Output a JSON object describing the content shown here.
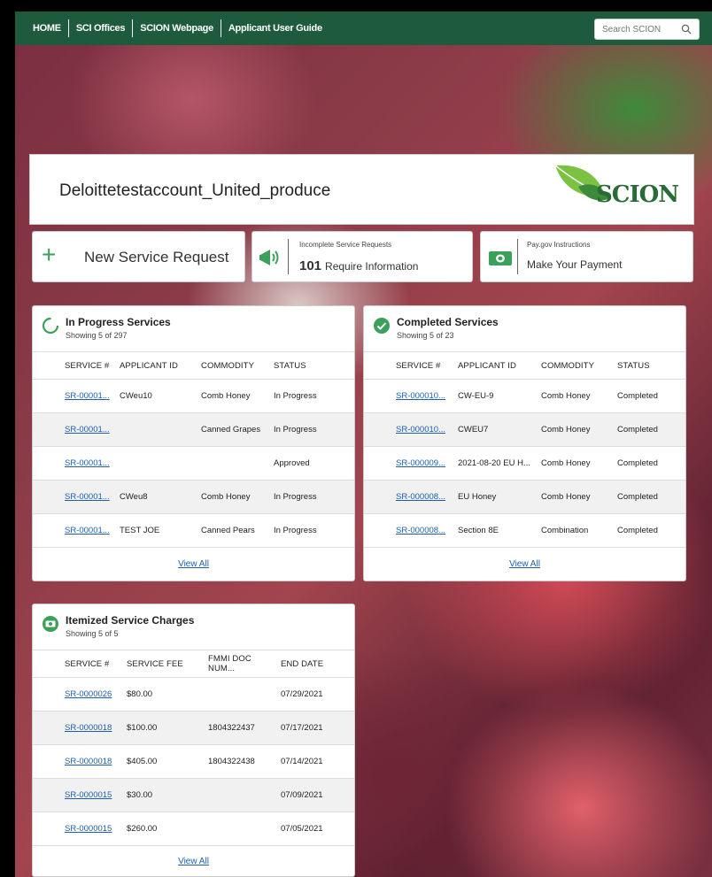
{
  "nav": {
    "items": [
      "HOME",
      "SCI Offices",
      "SCION Webpage",
      "Applicant User Guide"
    ],
    "search_placeholder": "Search SCION"
  },
  "account": {
    "name": "Deloittetestaccount_United_produce",
    "logo_text": "SCION"
  },
  "tiles": {
    "new_request": "New Service Request",
    "incomplete_small": "Incomplete Service Requests",
    "incomplete_count": "101",
    "incomplete_label": "Require Information",
    "paygov_small": "Pay.gov Instructions",
    "paygov_label": "Make Your Payment"
  },
  "in_progress": {
    "title": "In Progress Services",
    "showing": "Showing 5 of 297",
    "columns": [
      "SERVICE #",
      "APPLICANT ID",
      "COMMODITY",
      "STATUS"
    ],
    "rows": [
      [
        "SR-00001...",
        "CWeu10",
        "Comb Honey",
        "In Progress"
      ],
      [
        "SR-00001...",
        "",
        "Canned Grapes",
        "In Progress"
      ],
      [
        "SR-00001...",
        "",
        "",
        "Approved"
      ],
      [
        "SR-00001...",
        "CWeu8",
        "Comb Honey",
        "In Progress"
      ],
      [
        "SR-00001...",
        "TEST JOE",
        "Canned Pears",
        "In Progress"
      ]
    ],
    "view_all": "View All"
  },
  "completed": {
    "title": "Completed Services",
    "showing": "Showing 5 of 23",
    "columns": [
      "SERVICE #",
      "APPLICANT ID",
      "COMMODITY",
      "STATUS"
    ],
    "rows": [
      [
        "SR-000010...",
        "CW-EU-9",
        "Comb Honey",
        "Completed"
      ],
      [
        "SR-000010...",
        "CWEU7",
        "Comb Honey",
        "Completed"
      ],
      [
        "SR-000009...",
        "2021-08-20 EU H...",
        "Comb Honey",
        "Completed"
      ],
      [
        "SR-000008...",
        "EU Honey",
        "Comb Honey",
        "Completed"
      ],
      [
        "SR-000008...",
        "Section 8E",
        "Combination",
        "Completed"
      ]
    ],
    "view_all": "View All"
  },
  "charges": {
    "title": "Itemized Service Charges",
    "showing": "Showing 5 of 5",
    "columns": [
      "SERVICE #",
      "SERVICE FEE",
      "FMMI DOC NUM...",
      "END DATE"
    ],
    "rows": [
      [
        "SR-0000026",
        "$80.00",
        "",
        "07/29/2021"
      ],
      [
        "SR-0000018",
        "$100.00",
        "1804322437",
        "07/17/2021"
      ],
      [
        "SR-0000018",
        "$405.00",
        "1804322438",
        "07/14/2021"
      ],
      [
        "SR-0000015",
        "$30.00",
        "",
        "07/09/2021"
      ],
      [
        "SR-0000015",
        "$260.00",
        "",
        "07/05/2021"
      ]
    ],
    "view_all": "View All"
  },
  "colors": {
    "nav_bg": "#1e5b3d",
    "accent_green": "#3aa05a",
    "link_blue": "#1c5fb0"
  }
}
